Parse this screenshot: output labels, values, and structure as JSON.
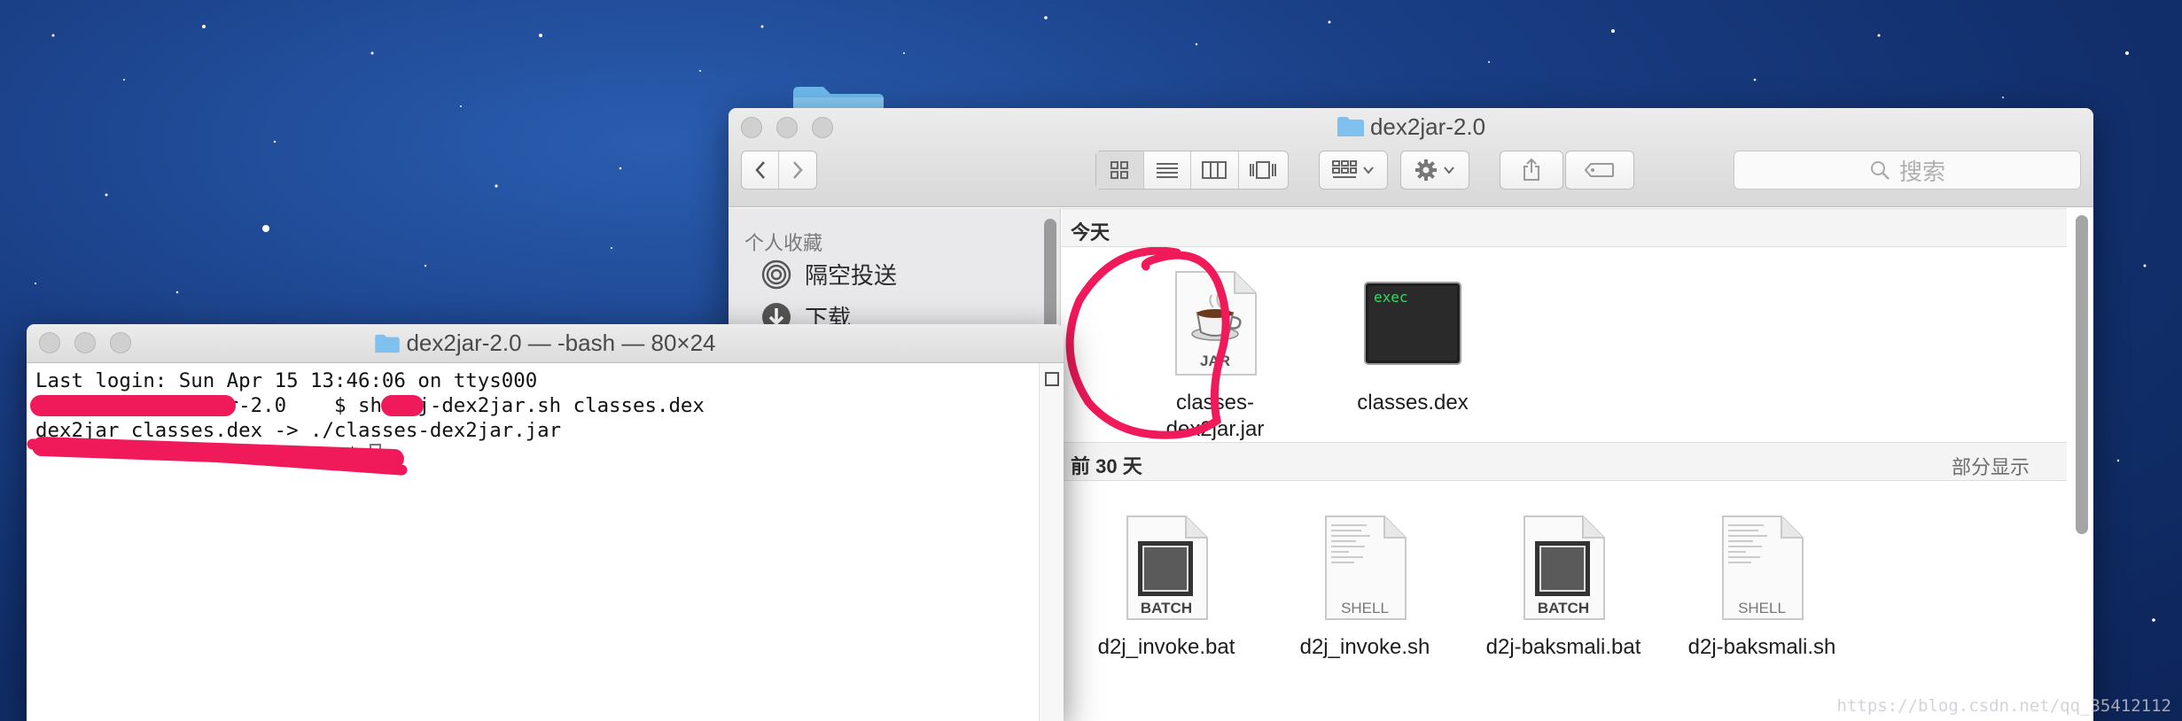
{
  "desktop": {
    "watermark": "https://blog.csdn.net/qq_35412112"
  },
  "finder": {
    "title": "dex2jar-2.0",
    "toolbar": {
      "back_icon": "chevron-left",
      "forward_icon": "chevron-right",
      "view_icons": [
        "icon-view",
        "list-view",
        "column-view",
        "cover-flow-view"
      ],
      "arrange_icon": "arrange-grid",
      "action_icon": "gear",
      "share_icon": "share",
      "tag_icon": "tag",
      "search_placeholder": "搜索"
    },
    "sidebar": {
      "heading": "个人收藏",
      "items": [
        {
          "label": "隔空投送",
          "icon": "airdrop-icon"
        },
        {
          "label": "下载",
          "icon": "download-icon"
        }
      ]
    },
    "sections": [
      {
        "heading": "今天",
        "files": [
          {
            "name": "classes-dex2jar.jar",
            "name_line1": "classes-",
            "name_line2": "dex2jar.jar",
            "type_badge": "JAR"
          },
          {
            "name": "classes.dex",
            "type_badge": "exec"
          }
        ]
      },
      {
        "heading": "前 30 天",
        "more": "部分显示",
        "files": [
          {
            "name": "d2j_invoke.bat",
            "type_badge": "BATCH"
          },
          {
            "name": "d2j_invoke.sh",
            "type_badge": "SHELL"
          },
          {
            "name": "d2j-baksmali.bat",
            "type_badge": "BATCH"
          },
          {
            "name": "d2j-baksmali.sh",
            "type_badge": "SHELL"
          }
        ]
      }
    ]
  },
  "terminal": {
    "title": "dex2jar-2.0 — -bash — 80×24",
    "lines": [
      "Last login: Sun Apr 15 13:46:06 on ttys000",
      "          dex2jar-2.0    $ sh d2j-dex2jar.sh classes.dex",
      "dex2jar classes.dex -> ./classes-dex2jar.jar",
      "                          $ "
    ]
  },
  "colors": {
    "annotation": "#f0195a",
    "desktop_blue": "#1a3f86"
  }
}
